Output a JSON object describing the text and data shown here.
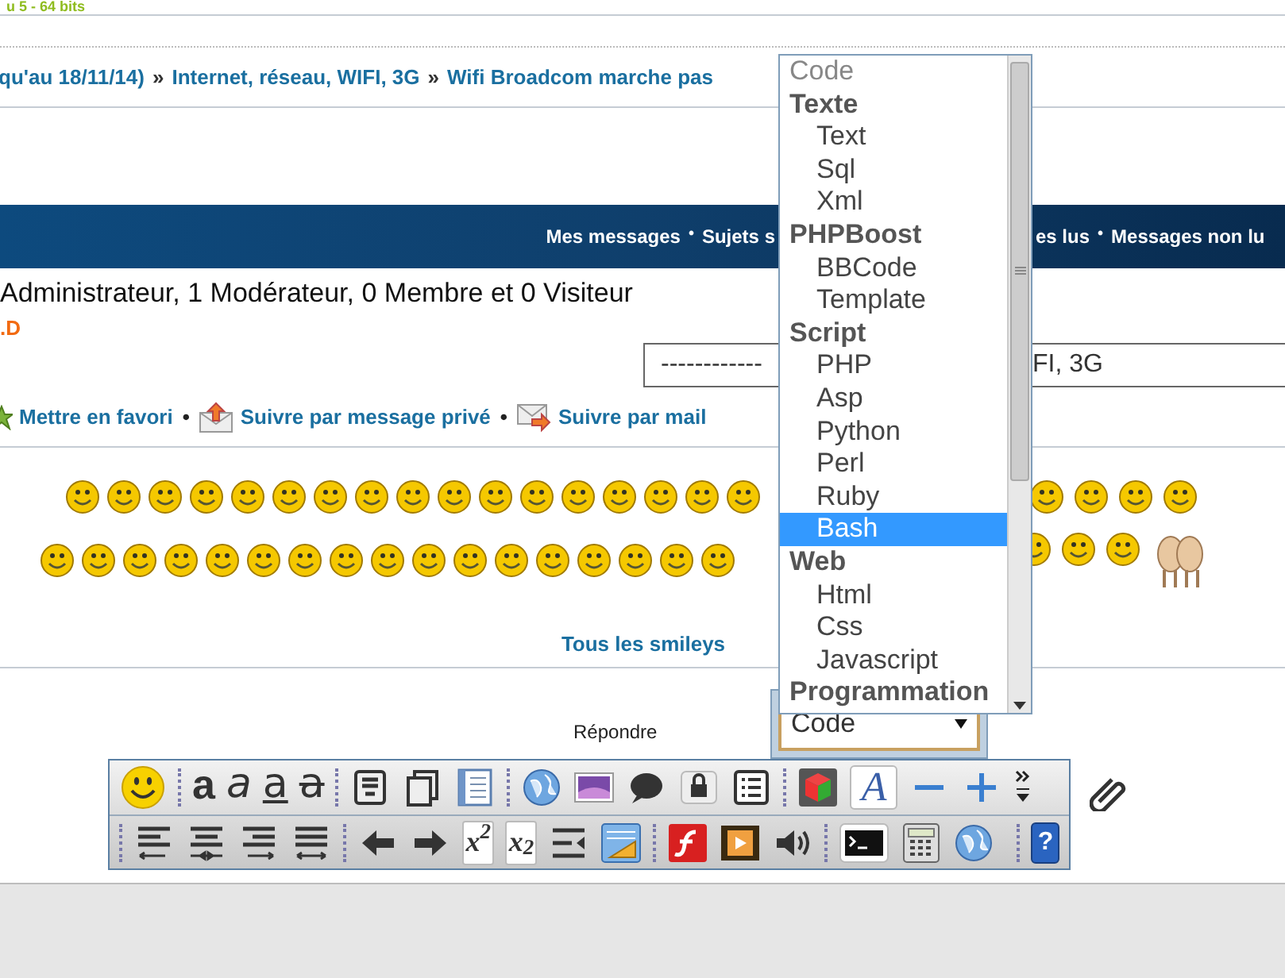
{
  "top_text": "u 5 - 64 bits",
  "breadcrumb": [
    {
      "kind": "link",
      "text": "qu'au 18/11/14)"
    },
    {
      "kind": "sep",
      "text": "»"
    },
    {
      "kind": "link",
      "text": "Internet, réseau, WIFI, 3G"
    },
    {
      "kind": "sep",
      "text": "»"
    },
    {
      "kind": "link",
      "text": "Wifi Broadcom marche pas"
    }
  ],
  "nav_bar": {
    "left": [
      {
        "kind": "link",
        "text": "Mes messages"
      },
      {
        "kind": "sep",
        "text": "•"
      },
      {
        "kind": "link",
        "text": "Sujets s"
      }
    ],
    "right": [
      {
        "kind": "link",
        "text": "es lus"
      },
      {
        "kind": "sep",
        "text": "•"
      },
      {
        "kind": "link",
        "text": "Messages non lu"
      }
    ]
  },
  "online": "Administrateur, 1 Modérateur, 0 Membre et 0 Visiteur",
  "online_member": ".D",
  "jump_select": {
    "visible_text": [
      "------------",
      "FI, 3G"
    ]
  },
  "follow_links": [
    {
      "kind": "favorite",
      "text": "Mettre en favori"
    },
    {
      "kind": "sep",
      "text": "•"
    },
    {
      "kind": "pm",
      "text": "Suivre par message privé"
    },
    {
      "kind": "sep",
      "text": "•"
    },
    {
      "kind": "mail",
      "text": "Suivre par mail"
    }
  ],
  "smileys_link": "Tous les smileys",
  "reply_label": "Répondre",
  "code_select": {
    "value": "Code"
  },
  "toolbar_rows": [
    [
      {
        "kind": "smiley"
      },
      {
        "kind": "sep"
      },
      {
        "kind": "bold",
        "label": "a"
      },
      {
        "kind": "italic",
        "label": "a"
      },
      {
        "kind": "underline",
        "label": "a"
      },
      {
        "kind": "strike",
        "label": "a"
      },
      {
        "kind": "sep"
      },
      {
        "kind": "note"
      },
      {
        "kind": "copy"
      },
      {
        "kind": "doc"
      },
      {
        "kind": "sep"
      },
      {
        "kind": "globe"
      },
      {
        "kind": "image"
      },
      {
        "kind": "bubble"
      },
      {
        "kind": "lock"
      },
      {
        "kind": "list"
      },
      {
        "kind": "sep"
      },
      {
        "kind": "cube"
      },
      {
        "kind": "font",
        "label": "A"
      },
      {
        "kind": "minus"
      },
      {
        "kind": "plus"
      },
      {
        "kind": "more"
      }
    ],
    [
      {
        "kind": "sep"
      },
      {
        "kind": "align-left"
      },
      {
        "kind": "align-center"
      },
      {
        "kind": "align-right"
      },
      {
        "kind": "justify"
      },
      {
        "kind": "sep"
      },
      {
        "kind": "arrow-left"
      },
      {
        "kind": "arrow-right"
      },
      {
        "kind": "sup",
        "label": "x$^{2}$"
      },
      {
        "kind": "sub",
        "label": "x$_{2}$"
      },
      {
        "kind": "indent"
      },
      {
        "kind": "table"
      },
      {
        "kind": "sep"
      },
      {
        "kind": "flash"
      },
      {
        "kind": "video"
      },
      {
        "kind": "sound"
      },
      {
        "kind": "sep"
      },
      {
        "kind": "terminal"
      },
      {
        "kind": "calculator"
      },
      {
        "kind": "globe"
      },
      {
        "kind": "gap"
      },
      {
        "kind": "sep"
      },
      {
        "kind": "help",
        "label": "?"
      }
    ]
  ],
  "dropdown": [
    {
      "kind": "placeholder",
      "text": "Code"
    },
    {
      "kind": "group",
      "text": "Texte"
    },
    {
      "kind": "option",
      "text": "Text",
      "selected": false
    },
    {
      "kind": "option",
      "text": "Sql",
      "selected": false
    },
    {
      "kind": "option",
      "text": "Xml",
      "selected": false
    },
    {
      "kind": "group",
      "text": "PHPBoost"
    },
    {
      "kind": "option",
      "text": "BBCode",
      "selected": false
    },
    {
      "kind": "option",
      "text": "Template",
      "selected": false
    },
    {
      "kind": "group",
      "text": "Script"
    },
    {
      "kind": "option",
      "text": "PHP",
      "selected": false
    },
    {
      "kind": "option",
      "text": "Asp",
      "selected": false
    },
    {
      "kind": "option",
      "text": "Python",
      "selected": false
    },
    {
      "kind": "option",
      "text": "Perl",
      "selected": false
    },
    {
      "kind": "option",
      "text": "Ruby",
      "selected": false
    },
    {
      "kind": "option",
      "text": "Bash",
      "selected": true
    },
    {
      "kind": "group",
      "text": "Web"
    },
    {
      "kind": "option",
      "text": "Html",
      "selected": false
    },
    {
      "kind": "option",
      "text": "Css",
      "selected": false
    },
    {
      "kind": "option",
      "text": "Javascript",
      "selected": false
    },
    {
      "kind": "group",
      "text": "Programmation"
    }
  ]
}
